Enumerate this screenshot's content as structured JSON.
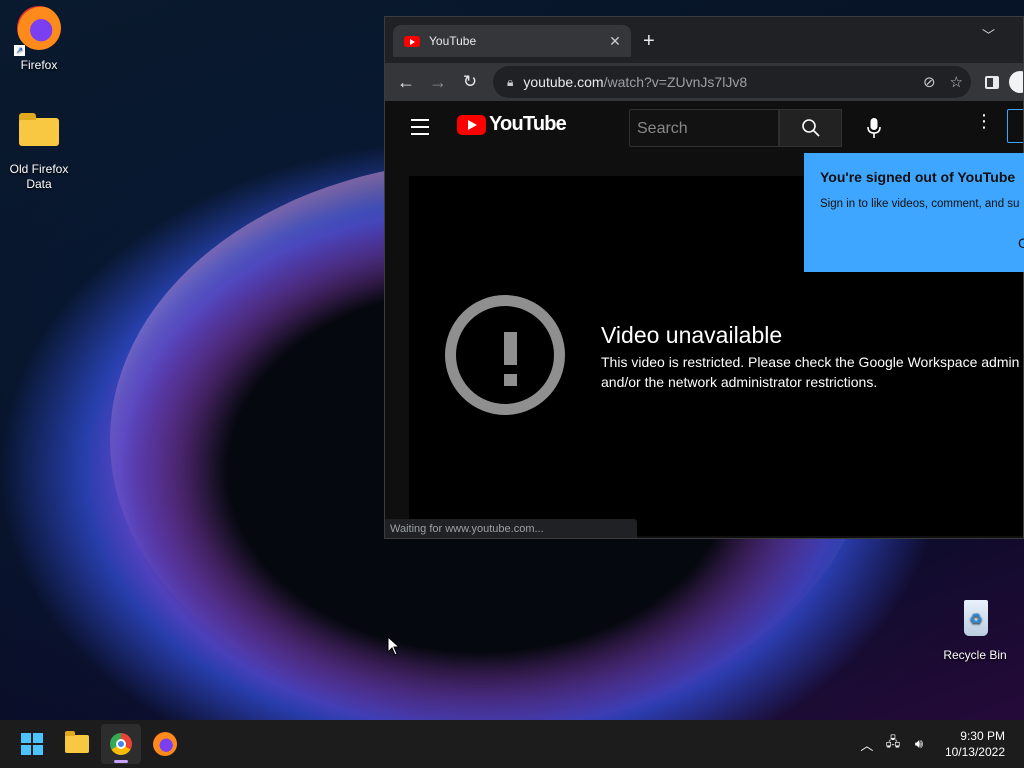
{
  "desktop": {
    "icons": [
      {
        "label": "Firefox"
      },
      {
        "label": "Old Firefox Data"
      },
      {
        "label": "Recycle Bin"
      }
    ]
  },
  "browser": {
    "tab": {
      "title": "YouTube"
    },
    "omnibox": {
      "host": "youtube.com",
      "path": "/watch?v=ZUvnJs7lJv8"
    },
    "status_text": "Waiting for www.youtube.com..."
  },
  "youtube": {
    "logo_text": "YouTube",
    "search_placeholder": "Search",
    "signed_out": {
      "title": "You're signed out of YouTube",
      "body": "Sign in to like videos, comment, and su",
      "button_fragment": "G"
    },
    "error": {
      "title": "Video unavailable",
      "message": "This video is restricted. Please check the Google Workspace admin and/or the network administrator restrictions."
    }
  },
  "taskbar": {
    "clock": {
      "time": "9:30 PM",
      "date": "10/13/2022"
    }
  },
  "colors": {
    "accent": "#3ea6ff",
    "youtube_red": "#ff0000"
  }
}
